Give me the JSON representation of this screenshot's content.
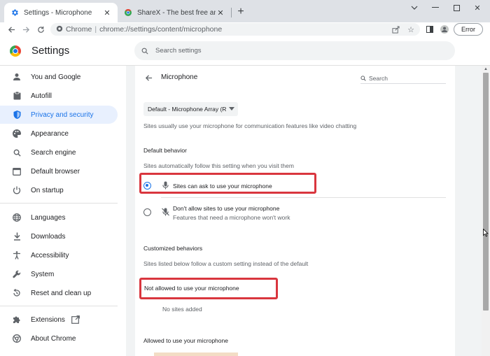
{
  "browser": {
    "tabs": [
      {
        "title": "Settings - Microphone",
        "active": true
      },
      {
        "title": "ShareX - The best free and open",
        "active": false
      }
    ],
    "address": {
      "site": "Chrome",
      "url": "chrome://settings/content/microphone"
    },
    "profile_error": "Error"
  },
  "settings": {
    "title": "Settings",
    "search_placeholder": "Search settings"
  },
  "sidebar": {
    "items": [
      {
        "label": "You and Google",
        "icon": "person-icon"
      },
      {
        "label": "Autofill",
        "icon": "clipboard-icon"
      },
      {
        "label": "Privacy and security",
        "icon": "shield-icon",
        "selected": true
      },
      {
        "label": "Appearance",
        "icon": "palette-icon"
      },
      {
        "label": "Search engine",
        "icon": "search-icon"
      },
      {
        "label": "Default browser",
        "icon": "browser-icon"
      },
      {
        "label": "On startup",
        "icon": "power-icon"
      },
      {
        "label": "Languages",
        "icon": "globe-icon"
      },
      {
        "label": "Downloads",
        "icon": "download-icon"
      },
      {
        "label": "Accessibility",
        "icon": "accessibility-icon"
      },
      {
        "label": "System",
        "icon": "wrench-icon"
      },
      {
        "label": "Reset and clean up",
        "icon": "reset-icon"
      },
      {
        "label": "Extensions",
        "icon": "puzzle-icon"
      },
      {
        "label": "About Chrome",
        "icon": "chrome-icon"
      }
    ]
  },
  "page": {
    "title": "Microphone",
    "search_placeholder": "Search",
    "device": "Default - Microphone Array (R",
    "intro": "Sites usually use your microphone for communication features like video chatting",
    "default_behavior": {
      "heading": "Default behavior",
      "description": "Sites automatically follow this setting when you visit them",
      "options": [
        {
          "label": "Sites can ask to use your microphone",
          "sub": "",
          "selected": true
        },
        {
          "label": "Don't allow sites to use your microphone",
          "sub": "Features that need a microphone won't work",
          "selected": false
        }
      ]
    },
    "customized": {
      "heading": "Customized behaviors",
      "description": "Sites listed below follow a custom setting instead of the default",
      "not_allowed_heading": "Not allowed to use your microphone",
      "no_sites": "No sites added",
      "allowed_heading": "Allowed to use your microphone"
    }
  },
  "colors": {
    "accent": "#1a73e8",
    "highlight": "#d9363e",
    "selected_bg": "#e8f0fe"
  }
}
